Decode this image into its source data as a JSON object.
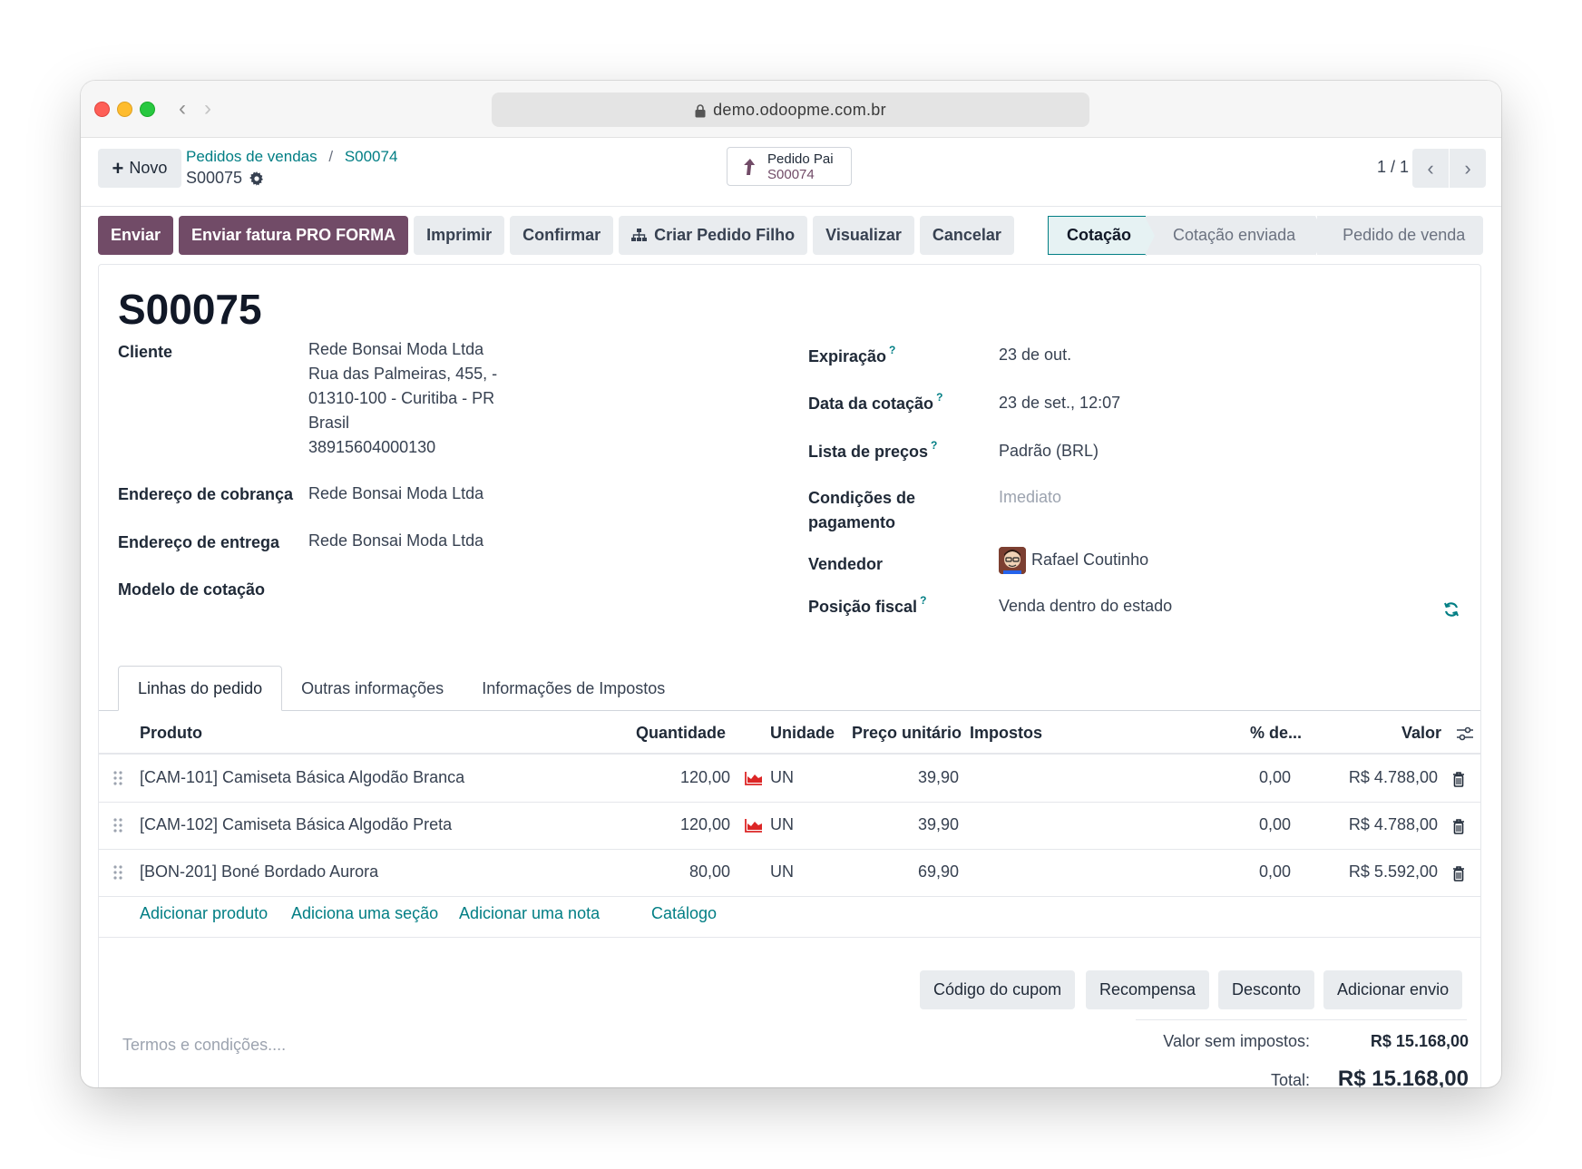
{
  "browser": {
    "url": "demo.odoopme.com.br"
  },
  "control": {
    "new_label": "Novo",
    "breadcrumb_parent": "Pedidos de vendas",
    "breadcrumb_sep": "/",
    "breadcrumb_prev": "S00074",
    "breadcrumb_current": "S00075",
    "parent_button_label": "Pedido Pai",
    "parent_button_value": "S00074",
    "pager": "1 / 1"
  },
  "actions": [
    {
      "label": "Enviar",
      "primary": true
    },
    {
      "label": "Enviar fatura PRO FORMA",
      "primary": true
    },
    {
      "label": "Imprimir",
      "primary": false
    },
    {
      "label": "Confirmar",
      "primary": false
    },
    {
      "label": "Criar Pedido Filho",
      "primary": false,
      "icon": "sitemap-icon"
    },
    {
      "label": "Visualizar",
      "primary": false
    },
    {
      "label": "Cancelar",
      "primary": false
    }
  ],
  "status": {
    "stages": [
      "Cotação",
      "Cotação enviada",
      "Pedido de venda"
    ],
    "active": "Cotação"
  },
  "form": {
    "title": "S00075",
    "customer_label": "Cliente",
    "customer_lines": [
      "Rede Bonsai Moda Ltda",
      "Rua das Palmeiras, 455, -",
      "01310-100 - Curitiba - PR",
      "Brasil",
      "38915604000130"
    ],
    "billing_label": "Endereço de cobrança",
    "billing_value": "Rede Bonsai Moda Ltda",
    "shipping_label": "Endereço de entrega",
    "shipping_value": "Rede Bonsai Moda Ltda",
    "template_label": "Modelo de cotação",
    "expiration_label": "Expiração",
    "expiration_value": "23 de out.",
    "quote_date_label": "Data da cotação",
    "quote_date_value": "23 de set., 12:07",
    "pricelist_label": "Lista de preços",
    "pricelist_value": "Padrão (BRL)",
    "payment_terms_label_1": "Condições de",
    "payment_terms_label_2": "pagamento",
    "payment_terms_placeholder": "Imediato",
    "salesperson_label": "Vendedor",
    "salesperson_value": "Rafael Coutinho",
    "fiscal_label": "Posição fiscal",
    "fiscal_value": "Venda dentro do estado",
    "help_mark": "?"
  },
  "tabs": [
    "Linhas do pedido",
    "Outras informações",
    "Informações de Impostos"
  ],
  "table": {
    "headers": {
      "product": "Produto",
      "quantity": "Quantidade",
      "unit": "Unidade",
      "price": "Preço unitário",
      "taxes": "Impostos",
      "discount": "% de...",
      "amount": "Valor"
    },
    "rows": [
      {
        "product": "[CAM-101] Camiseta Básica Algodão Branca",
        "quantity": "120,00",
        "unit": "UN",
        "price": "39,90",
        "discount": "0,00",
        "amount": "R$ 4.788,00"
      },
      {
        "product": "[CAM-102] Camiseta Básica Algodão Preta",
        "quantity": "120,00",
        "unit": "UN",
        "price": "39,90",
        "discount": "0,00",
        "amount": "R$ 4.788,00"
      },
      {
        "product": "[BON-201] Boné Bordado Aurora",
        "quantity": "80,00",
        "unit": "UN",
        "price": "69,90",
        "discount": "0,00",
        "amount": "R$ 5.592,00"
      }
    ],
    "add_links": [
      "Adicionar produto",
      "Adiciona uma seção",
      "Adicionar uma nota",
      "Catálogo"
    ]
  },
  "bottom_buttons": [
    "Código do cupom",
    "Recompensa",
    "Desconto",
    "Adicionar envio"
  ],
  "terms_placeholder": "Termos e condições....",
  "totals": {
    "untaxed_label": "Valor sem impostos:",
    "untaxed_value": "R$ 15.168,00",
    "total_label": "Total:",
    "total_value": "R$ 15.168,00"
  },
  "colors": {
    "primary": "#714b67",
    "link": "#017e84"
  }
}
